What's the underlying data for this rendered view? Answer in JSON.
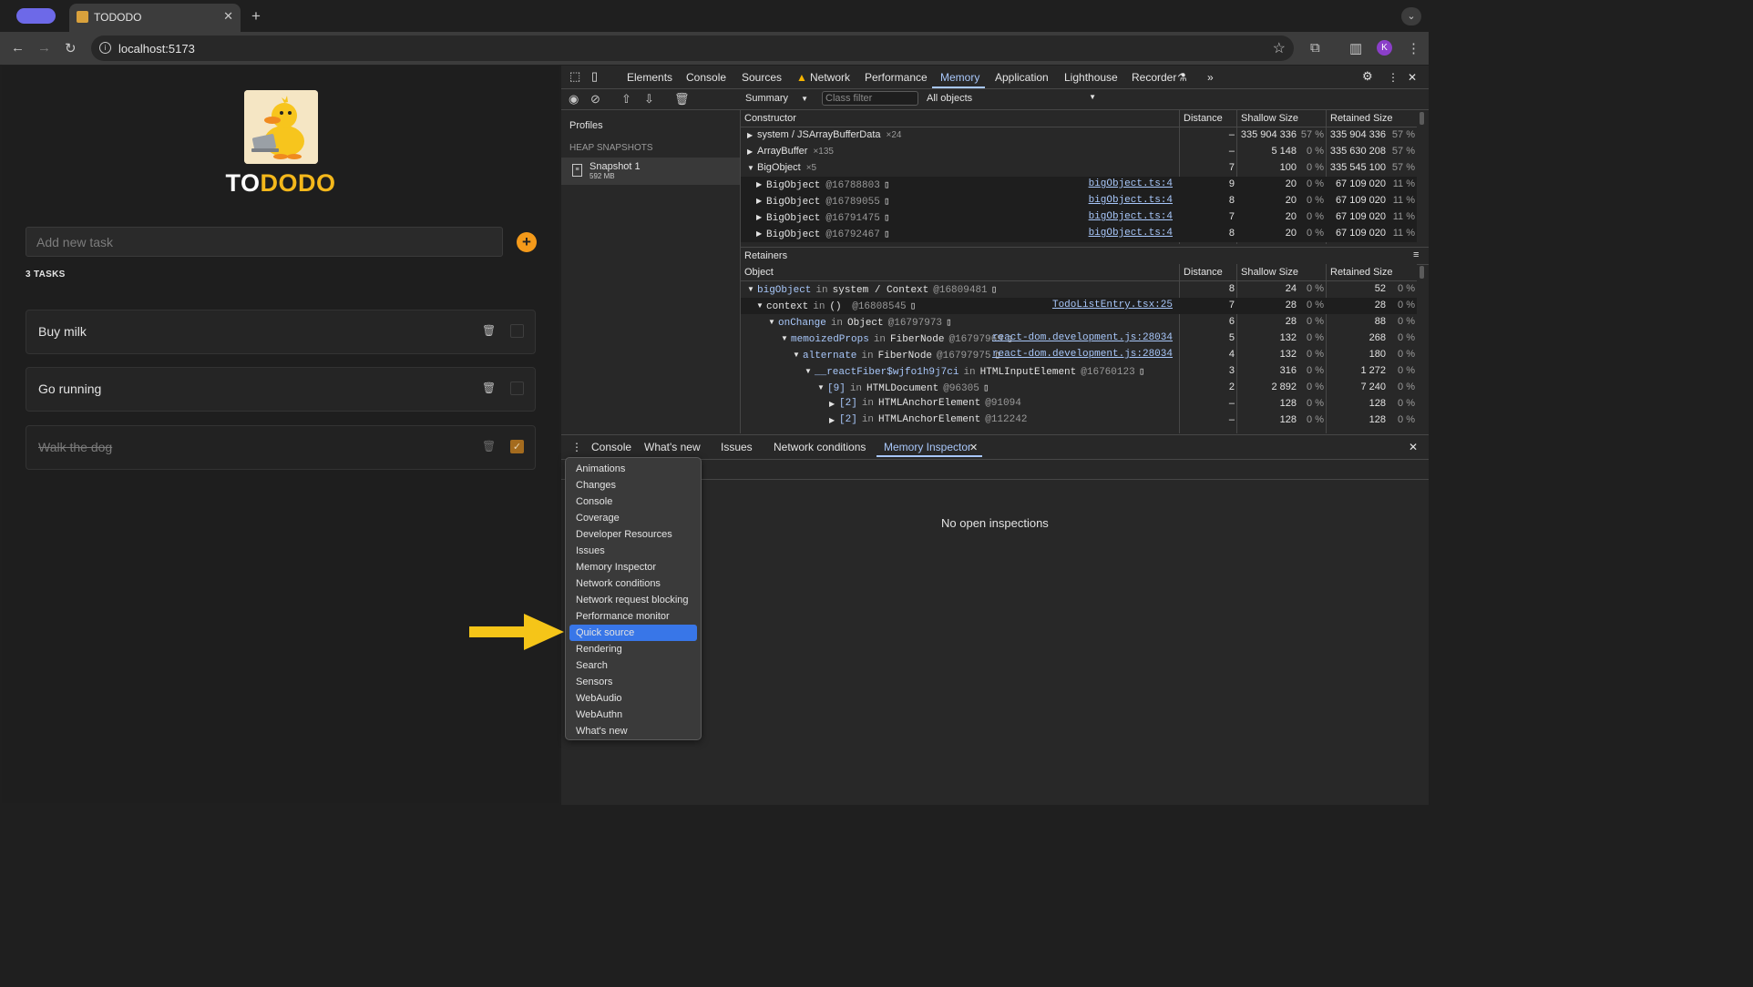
{
  "browser": {
    "tab_title": "TODODO",
    "url": "localhost:5173",
    "avatar_letter": "K"
  },
  "app": {
    "title_part1": "TO",
    "title_part2": "DODO",
    "accent": "#f4b81b",
    "input_placeholder": "Add new task",
    "add_label": "+",
    "task_count": "3 TASKS",
    "tasks": [
      {
        "label": "Buy milk",
        "done": false
      },
      {
        "label": "Go running",
        "done": false
      },
      {
        "label": "Walk the dog",
        "done": true
      }
    ]
  },
  "devtools": {
    "tabs": [
      "Elements",
      "Console",
      "Sources",
      "Network",
      "Performance",
      "Memory",
      "Application",
      "Lighthouse",
      "Recorder"
    ],
    "active_tab": "Memory",
    "summary_select": "Summary",
    "class_filter_placeholder": "Class filter",
    "objects_select": "All objects",
    "profiles_title": "Profiles",
    "heap_snapshots_title": "HEAP SNAPSHOTS",
    "snapshot_name": "Snapshot 1",
    "snapshot_size": "592 MB",
    "constructor_headers": [
      "Constructor",
      "Distance",
      "Shallow Size",
      "Retained Size"
    ],
    "constructors": [
      {
        "name": "system / JSArrayBufferData",
        "count": "×24",
        "distance": "–",
        "shallow": "335 904 336",
        "shallow_pct": "57 %",
        "retained": "335 904 336",
        "retained_pct": "57 %"
      },
      {
        "name": "ArrayBuffer",
        "count": "×135",
        "distance": "–",
        "shallow": "5 148",
        "shallow_pct": "0 %",
        "retained": "335 630 208",
        "retained_pct": "57 %"
      },
      {
        "name": "BigObject",
        "count": "×5",
        "distance": "7",
        "shallow": "100",
        "shallow_pct": "0 %",
        "retained": "335 545 100",
        "retained_pct": "57 %"
      }
    ],
    "bigobjects": [
      {
        "name": "BigObject",
        "id": "@16788803",
        "link": "bigObject.ts:4",
        "distance": "9",
        "shallow": "20",
        "shallow_pct": "0 %",
        "retained": "67 109 020",
        "retained_pct": "11 %"
      },
      {
        "name": "BigObject",
        "id": "@16789055",
        "link": "bigObject.ts:4",
        "distance": "8",
        "shallow": "20",
        "shallow_pct": "0 %",
        "retained": "67 109 020",
        "retained_pct": "11 %"
      },
      {
        "name": "BigObject",
        "id": "@16791475",
        "link": "bigObject.ts:4",
        "distance": "7",
        "shallow": "20",
        "shallow_pct": "0 %",
        "retained": "67 109 020",
        "retained_pct": "11 %"
      },
      {
        "name": "BigObject",
        "id": "@16792467",
        "link": "bigObject.ts:4",
        "distance": "8",
        "shallow": "20",
        "shallow_pct": "0 %",
        "retained": "67 109 020",
        "retained_pct": "11 %"
      }
    ],
    "retainers_title": "Retainers",
    "retainer_headers": [
      "Object",
      "Distance",
      "Shallow Size",
      "Retained Size"
    ],
    "retainers": [
      {
        "prop": "bigObject",
        "in": "in",
        "obj": "system / Context",
        "id": "@16809481",
        "link": "",
        "distance": "8",
        "shallow": "24",
        "shallow_pct": "0 %",
        "retained": "52",
        "retained_pct": "0 %"
      },
      {
        "prop": "context",
        "in": "in",
        "obj": "() ",
        "id": "@16808545",
        "link": "TodoListEntry.tsx:25",
        "distance": "7",
        "shallow": "28",
        "shallow_pct": "0 %",
        "retained": "28",
        "retained_pct": "0 %"
      },
      {
        "prop": "onChange",
        "in": "in",
        "obj": "Object",
        "id": "@16797973",
        "link": "",
        "distance": "6",
        "shallow": "28",
        "shallow_pct": "0 %",
        "retained": "88",
        "retained_pct": "0 %"
      },
      {
        "prop": "memoizedProps",
        "in": "in",
        "obj": "FiberNode",
        "id": "@16797969",
        "link": "react-dom.development.js:28034",
        "distance": "5",
        "shallow": "132",
        "shallow_pct": "0 %",
        "retained": "268",
        "retained_pct": "0 %"
      },
      {
        "prop": "alternate",
        "in": "in",
        "obj": "FiberNode",
        "id": "@16797975",
        "link": "react-dom.development.js:28034",
        "distance": "4",
        "shallow": "132",
        "shallow_pct": "0 %",
        "retained": "180",
        "retained_pct": "0 %"
      },
      {
        "prop": "__reactFiber$wjfo1h9j7ci",
        "in": "in",
        "obj": "HTMLInputElement",
        "id": "@16760123",
        "link": "",
        "distance": "3",
        "shallow": "316",
        "shallow_pct": "0 %",
        "retained": "1 272",
        "retained_pct": "0 %"
      },
      {
        "prop": "[9]",
        "in": "in",
        "obj": "HTMLDocument",
        "id": "@96305",
        "link": "",
        "distance": "2",
        "shallow": "2 892",
        "shallow_pct": "0 %",
        "retained": "7 240",
        "retained_pct": "0 %"
      },
      {
        "prop": "[2]",
        "in": "in",
        "obj": "HTMLAnchorElement",
        "id": "@91094",
        "link": "",
        "distance": "–",
        "shallow": "128",
        "shallow_pct": "0 %",
        "retained": "128",
        "retained_pct": "0 %"
      },
      {
        "prop": "[2]",
        "in": "in",
        "obj": "HTMLAnchorElement",
        "id": "@112242",
        "link": "",
        "distance": "–",
        "shallow": "128",
        "shallow_pct": "0 %",
        "retained": "128",
        "retained_pct": "0 %"
      }
    ],
    "drawer_tabs": [
      "Console",
      "What's new",
      "Issues",
      "Network conditions",
      "Memory Inspector"
    ],
    "drawer_active": "Memory Inspector",
    "no_inspections": "No open inspections",
    "menu_items": [
      "Animations",
      "Changes",
      "Console",
      "Coverage",
      "Developer Resources",
      "Issues",
      "Memory Inspector",
      "Network conditions",
      "Network request blocking",
      "Performance monitor",
      "Quick source",
      "Rendering",
      "Search",
      "Sensors",
      "WebAudio",
      "WebAuthn",
      "What's new"
    ],
    "menu_highlighted": "Quick source",
    "arrow_color": "#f5c518"
  }
}
